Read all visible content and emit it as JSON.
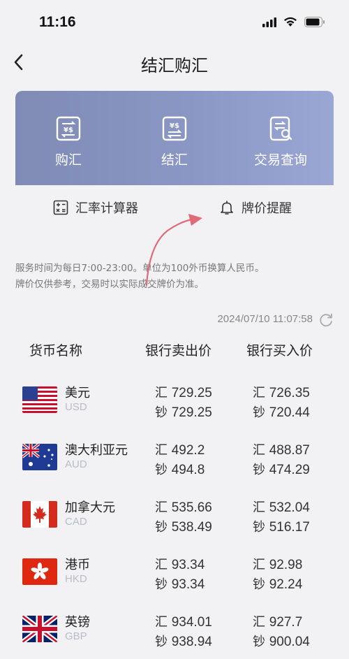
{
  "status": {
    "time": "11:16"
  },
  "nav": {
    "title": "结汇购汇"
  },
  "banner": {
    "items": [
      {
        "label": "购汇",
        "icon": "currency-exchange-icon"
      },
      {
        "label": "结汇",
        "icon": "currency-settle-icon"
      },
      {
        "label": "交易查询",
        "icon": "transaction-search-icon"
      }
    ]
  },
  "tools": {
    "calculator": "汇率计算器",
    "alert": "牌价提醒"
  },
  "notice": {
    "line1": "服务时间为每日7:00-23:00。单位为100外币换算人民币。",
    "line2": "牌价仅供参考，交易时以实际成交牌价为准。"
  },
  "update_time": "2024/07/10 11:07:58",
  "table": {
    "headers": [
      "货币名称",
      "银行卖出价",
      "银行买入价"
    ],
    "rows": [
      {
        "name": "美元",
        "code": "USD",
        "flag": "us",
        "sell_remit": "729.25",
        "sell_cash": "729.25",
        "buy_remit": "726.35",
        "buy_cash": "720.44"
      },
      {
        "name": "澳大利亚元",
        "code": "AUD",
        "flag": "au",
        "sell_remit": "492.2",
        "sell_cash": "494.8",
        "buy_remit": "488.87",
        "buy_cash": "474.29"
      },
      {
        "name": "加拿大元",
        "code": "CAD",
        "flag": "ca",
        "sell_remit": "535.66",
        "sell_cash": "538.49",
        "buy_remit": "532.04",
        "buy_cash": "516.17"
      },
      {
        "name": "港币",
        "code": "HKD",
        "flag": "hk",
        "sell_remit": "93.34",
        "sell_cash": "93.34",
        "buy_remit": "92.98",
        "buy_cash": "92.24"
      },
      {
        "name": "英镑",
        "code": "GBP",
        "flag": "gb",
        "sell_remit": "934.01",
        "sell_cash": "938.94",
        "buy_remit": "927.7",
        "buy_cash": "900.04"
      }
    ],
    "remit_label": "汇",
    "cash_label": "钞"
  },
  "colors": {
    "banner": "#8a97c4",
    "arrow": "#e06a78",
    "code_text": "#b9bcc8"
  }
}
